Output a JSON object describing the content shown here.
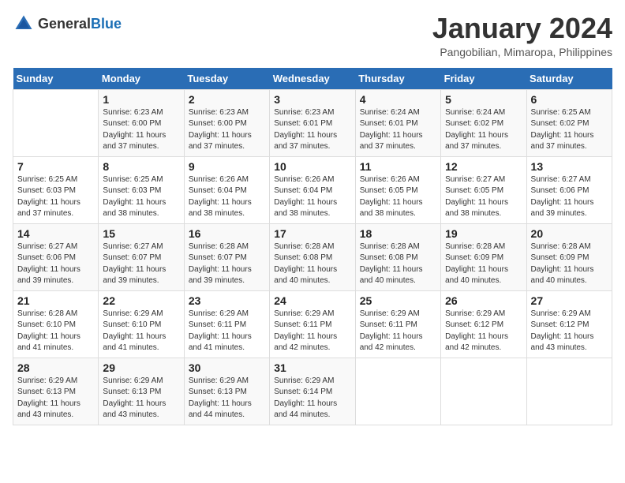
{
  "header": {
    "logo_general": "General",
    "logo_blue": "Blue",
    "title": "January 2024",
    "subtitle": "Pangobilian, Mimaropa, Philippines"
  },
  "calendar": {
    "days_of_week": [
      "Sunday",
      "Monday",
      "Tuesday",
      "Wednesday",
      "Thursday",
      "Friday",
      "Saturday"
    ],
    "weeks": [
      [
        {
          "day": "",
          "sunrise": "",
          "sunset": "",
          "daylight": ""
        },
        {
          "day": "1",
          "sunrise": "Sunrise: 6:23 AM",
          "sunset": "Sunset: 6:00 PM",
          "daylight": "Daylight: 11 hours and 37 minutes."
        },
        {
          "day": "2",
          "sunrise": "Sunrise: 6:23 AM",
          "sunset": "Sunset: 6:00 PM",
          "daylight": "Daylight: 11 hours and 37 minutes."
        },
        {
          "day": "3",
          "sunrise": "Sunrise: 6:23 AM",
          "sunset": "Sunset: 6:01 PM",
          "daylight": "Daylight: 11 hours and 37 minutes."
        },
        {
          "day": "4",
          "sunrise": "Sunrise: 6:24 AM",
          "sunset": "Sunset: 6:01 PM",
          "daylight": "Daylight: 11 hours and 37 minutes."
        },
        {
          "day": "5",
          "sunrise": "Sunrise: 6:24 AM",
          "sunset": "Sunset: 6:02 PM",
          "daylight": "Daylight: 11 hours and 37 minutes."
        },
        {
          "day": "6",
          "sunrise": "Sunrise: 6:25 AM",
          "sunset": "Sunset: 6:02 PM",
          "daylight": "Daylight: 11 hours and 37 minutes."
        }
      ],
      [
        {
          "day": "7",
          "sunrise": "Sunrise: 6:25 AM",
          "sunset": "Sunset: 6:03 PM",
          "daylight": "Daylight: 11 hours and 37 minutes."
        },
        {
          "day": "8",
          "sunrise": "Sunrise: 6:25 AM",
          "sunset": "Sunset: 6:03 PM",
          "daylight": "Daylight: 11 hours and 38 minutes."
        },
        {
          "day": "9",
          "sunrise": "Sunrise: 6:26 AM",
          "sunset": "Sunset: 6:04 PM",
          "daylight": "Daylight: 11 hours and 38 minutes."
        },
        {
          "day": "10",
          "sunrise": "Sunrise: 6:26 AM",
          "sunset": "Sunset: 6:04 PM",
          "daylight": "Daylight: 11 hours and 38 minutes."
        },
        {
          "day": "11",
          "sunrise": "Sunrise: 6:26 AM",
          "sunset": "Sunset: 6:05 PM",
          "daylight": "Daylight: 11 hours and 38 minutes."
        },
        {
          "day": "12",
          "sunrise": "Sunrise: 6:27 AM",
          "sunset": "Sunset: 6:05 PM",
          "daylight": "Daylight: 11 hours and 38 minutes."
        },
        {
          "day": "13",
          "sunrise": "Sunrise: 6:27 AM",
          "sunset": "Sunset: 6:06 PM",
          "daylight": "Daylight: 11 hours and 39 minutes."
        }
      ],
      [
        {
          "day": "14",
          "sunrise": "Sunrise: 6:27 AM",
          "sunset": "Sunset: 6:06 PM",
          "daylight": "Daylight: 11 hours and 39 minutes."
        },
        {
          "day": "15",
          "sunrise": "Sunrise: 6:27 AM",
          "sunset": "Sunset: 6:07 PM",
          "daylight": "Daylight: 11 hours and 39 minutes."
        },
        {
          "day": "16",
          "sunrise": "Sunrise: 6:28 AM",
          "sunset": "Sunset: 6:07 PM",
          "daylight": "Daylight: 11 hours and 39 minutes."
        },
        {
          "day": "17",
          "sunrise": "Sunrise: 6:28 AM",
          "sunset": "Sunset: 6:08 PM",
          "daylight": "Daylight: 11 hours and 40 minutes."
        },
        {
          "day": "18",
          "sunrise": "Sunrise: 6:28 AM",
          "sunset": "Sunset: 6:08 PM",
          "daylight": "Daylight: 11 hours and 40 minutes."
        },
        {
          "day": "19",
          "sunrise": "Sunrise: 6:28 AM",
          "sunset": "Sunset: 6:09 PM",
          "daylight": "Daylight: 11 hours and 40 minutes."
        },
        {
          "day": "20",
          "sunrise": "Sunrise: 6:28 AM",
          "sunset": "Sunset: 6:09 PM",
          "daylight": "Daylight: 11 hours and 40 minutes."
        }
      ],
      [
        {
          "day": "21",
          "sunrise": "Sunrise: 6:28 AM",
          "sunset": "Sunset: 6:10 PM",
          "daylight": "Daylight: 11 hours and 41 minutes."
        },
        {
          "day": "22",
          "sunrise": "Sunrise: 6:29 AM",
          "sunset": "Sunset: 6:10 PM",
          "daylight": "Daylight: 11 hours and 41 minutes."
        },
        {
          "day": "23",
          "sunrise": "Sunrise: 6:29 AM",
          "sunset": "Sunset: 6:11 PM",
          "daylight": "Daylight: 11 hours and 41 minutes."
        },
        {
          "day": "24",
          "sunrise": "Sunrise: 6:29 AM",
          "sunset": "Sunset: 6:11 PM",
          "daylight": "Daylight: 11 hours and 42 minutes."
        },
        {
          "day": "25",
          "sunrise": "Sunrise: 6:29 AM",
          "sunset": "Sunset: 6:11 PM",
          "daylight": "Daylight: 11 hours and 42 minutes."
        },
        {
          "day": "26",
          "sunrise": "Sunrise: 6:29 AM",
          "sunset": "Sunset: 6:12 PM",
          "daylight": "Daylight: 11 hours and 42 minutes."
        },
        {
          "day": "27",
          "sunrise": "Sunrise: 6:29 AM",
          "sunset": "Sunset: 6:12 PM",
          "daylight": "Daylight: 11 hours and 43 minutes."
        }
      ],
      [
        {
          "day": "28",
          "sunrise": "Sunrise: 6:29 AM",
          "sunset": "Sunset: 6:13 PM",
          "daylight": "Daylight: 11 hours and 43 minutes."
        },
        {
          "day": "29",
          "sunrise": "Sunrise: 6:29 AM",
          "sunset": "Sunset: 6:13 PM",
          "daylight": "Daylight: 11 hours and 43 minutes."
        },
        {
          "day": "30",
          "sunrise": "Sunrise: 6:29 AM",
          "sunset": "Sunset: 6:13 PM",
          "daylight": "Daylight: 11 hours and 44 minutes."
        },
        {
          "day": "31",
          "sunrise": "Sunrise: 6:29 AM",
          "sunset": "Sunset: 6:14 PM",
          "daylight": "Daylight: 11 hours and 44 minutes."
        },
        {
          "day": "",
          "sunrise": "",
          "sunset": "",
          "daylight": ""
        },
        {
          "day": "",
          "sunrise": "",
          "sunset": "",
          "daylight": ""
        },
        {
          "day": "",
          "sunrise": "",
          "sunset": "",
          "daylight": ""
        }
      ]
    ]
  }
}
